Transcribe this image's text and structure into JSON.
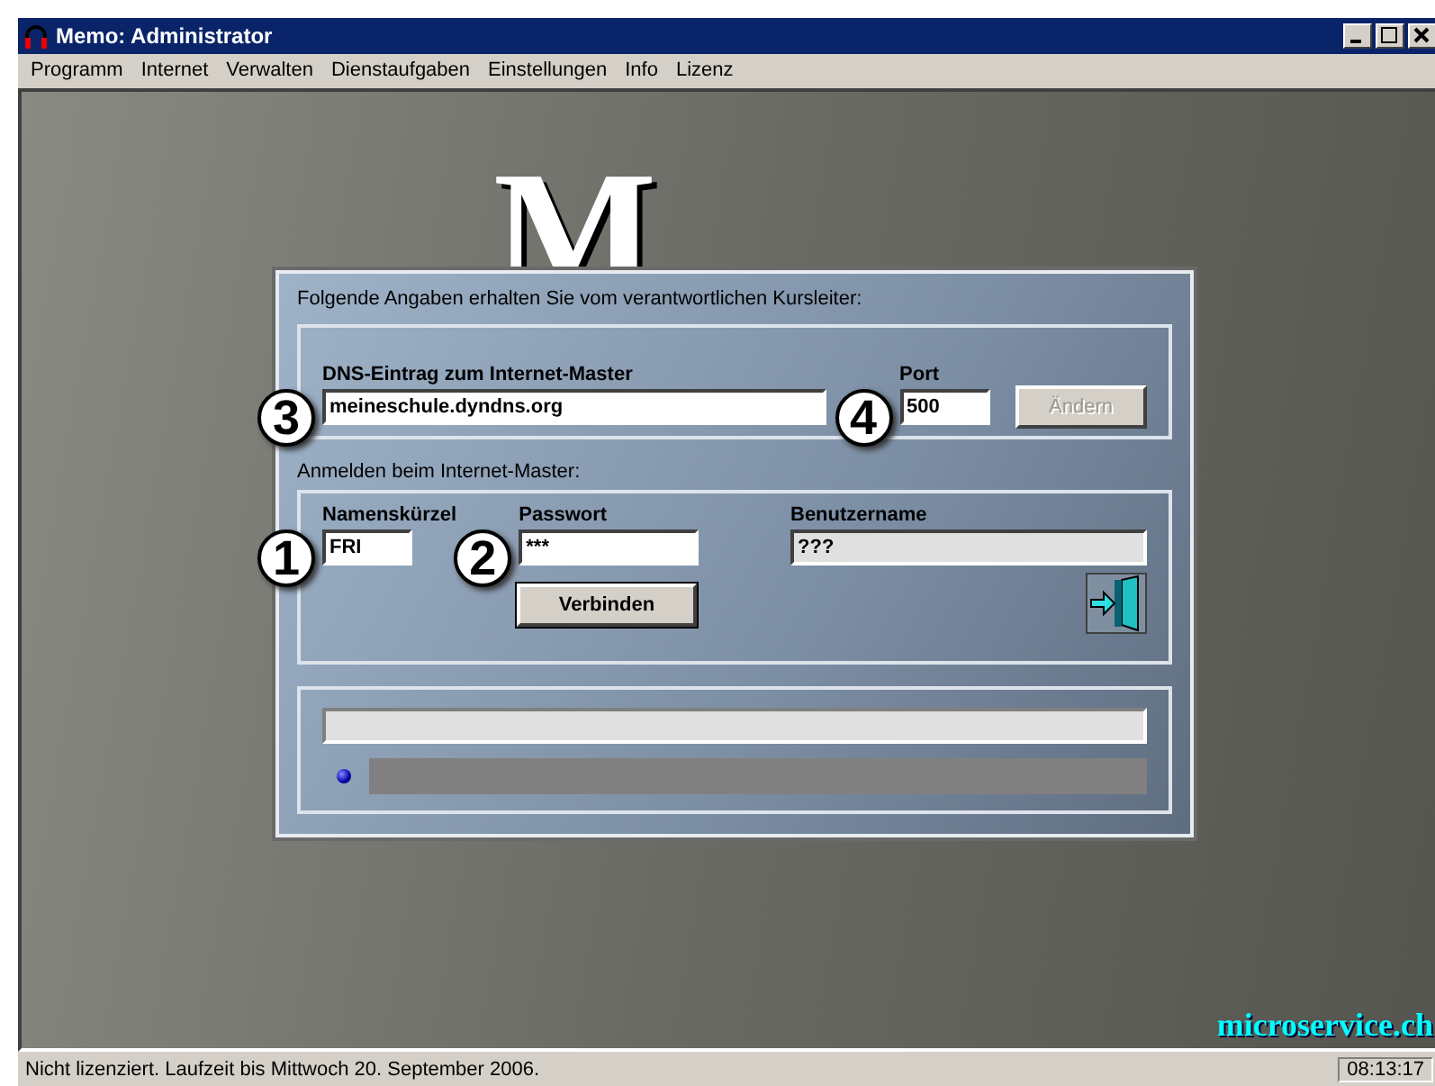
{
  "window": {
    "title": "Memo: Administrator"
  },
  "menu": [
    "Programm",
    "Internet",
    "Verwalten",
    "Dienstaufgaben",
    "Einstellungen",
    "Info",
    "Lizenz"
  ],
  "logo": "M",
  "dialog": {
    "intro": "Folgende Angaben erhalten Sie vom verantwortlichen Kursleiter:",
    "dns": {
      "label": "DNS-Eintrag zum Internet-Master",
      "value": "meineschule.dyndns.org",
      "marker": "3"
    },
    "port": {
      "label": "Port",
      "value": "500",
      "marker": "4"
    },
    "change_button": {
      "label": "Ändern",
      "disabled": true
    },
    "login_heading": "Anmelden beim Internet-Master:",
    "initials": {
      "label": "Namenskürzel",
      "value": "FRI",
      "marker": "1"
    },
    "password": {
      "label": "Passwort",
      "value": "***",
      "marker": "2"
    },
    "username": {
      "label": "Benutzername",
      "value": "???",
      "readonly": true
    },
    "connect_button": {
      "label": "Verbinden",
      "disabled": false
    }
  },
  "watermark_text": "microservice.ch",
  "status_bar": {
    "message": "Nicht lizenziert. Laufzeit bis Mittwoch 20. September 2006.",
    "time": "08:13:17"
  }
}
